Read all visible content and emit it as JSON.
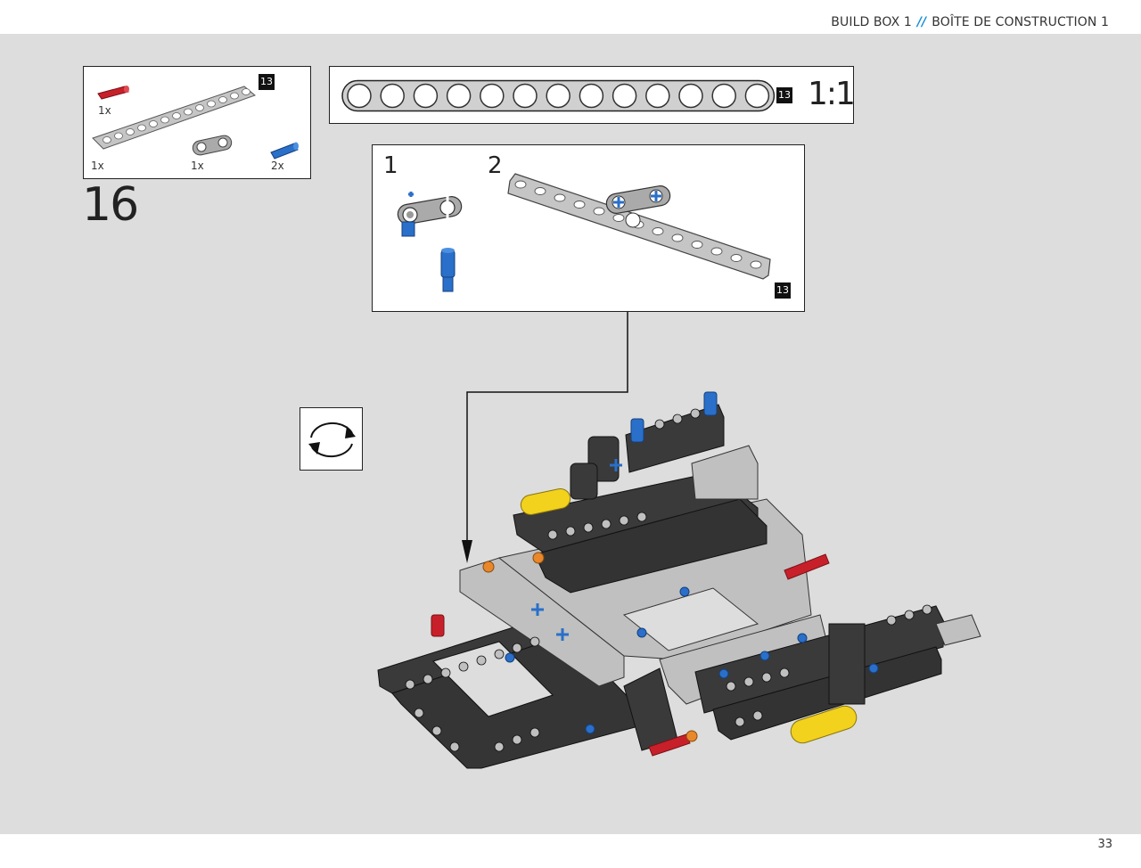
{
  "header": {
    "left": "BUILD BOX 1",
    "separator": "//",
    "right": "BOÎTE DE CONSTRUCTION 1"
  },
  "page_number": "33",
  "step": {
    "number": "16"
  },
  "parts_list": {
    "badge": "13",
    "items": [
      {
        "part": "red-pin-3l",
        "color": "#c8202a",
        "quantity": "1x"
      },
      {
        "part": "grey-beam-13",
        "color": "#b8b9b8",
        "quantity": "1x"
      },
      {
        "part": "grey-connector-2x1",
        "color": "#b8b9b8",
        "quantity": "1x"
      },
      {
        "part": "blue-pin",
        "color": "#2a6fc9",
        "quantity": "2x"
      }
    ]
  },
  "ruler": {
    "length": "13",
    "scale": "1:1",
    "holes": 13
  },
  "sub_assembly": {
    "steps": [
      "1",
      "2"
    ],
    "badge": "13"
  },
  "rotate_icon": "rotate-model-icon",
  "colors": {
    "page_bg": "#dcdddc",
    "accent": "#1a8fd6",
    "dark_beam": "#3a3a3a",
    "light_beam": "#bfc0bf",
    "blue": "#2a6fc9",
    "red": "#c8202a",
    "yellow": "#f2d21c",
    "orange": "#e8882a"
  }
}
